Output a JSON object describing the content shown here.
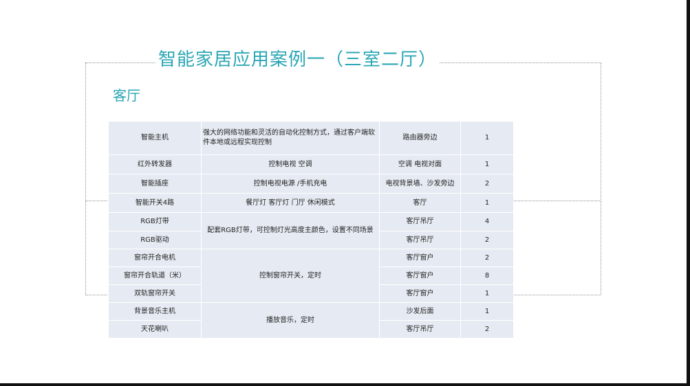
{
  "slide": {
    "title": "智能家居应用案例一（三室二厅）",
    "subtitle": "客厅"
  },
  "table": {
    "rows": [
      {
        "name": "智能主机",
        "desc": "强大的网络功能和灵活的自动化控制方式，通过客户端软件本地或远程实现控制",
        "location": "路由器旁边",
        "qty": "1"
      },
      {
        "name": "红外转发器",
        "desc": "控制电视 空调",
        "location": "空调 电视对面",
        "qty": "1"
      },
      {
        "name": "智能插座",
        "desc": "控制电视电源 /手机充电",
        "location": "电视背景墙、沙发旁边",
        "qty": "2"
      },
      {
        "name": "智能开关4路",
        "desc": "餐厅灯 客厅灯 门厅 休闲模式",
        "location": "客厅",
        "qty": "1"
      },
      {
        "name": "RGB灯带",
        "location": "客厅吊厅",
        "qty": "4"
      },
      {
        "name": "RGB驱动",
        "location": "客厅吊厅",
        "qty": "2"
      },
      {
        "name": "窗帘开合电机",
        "location": "客厅窗户",
        "qty": "2"
      },
      {
        "name": "窗帘开合轨道（米）",
        "location": "客厅窗户",
        "qty": "8"
      },
      {
        "name": "双轨窗帘开关",
        "location": "客厅窗户",
        "qty": "1"
      },
      {
        "name": "背景音乐主机",
        "location": "沙发后面",
        "qty": "1"
      },
      {
        "name": "天花喇叭",
        "location": "客厅吊厅",
        "qty": "2"
      }
    ],
    "merged_desc": {
      "rgb": "配套RGB灯带，可控制灯光高度主颜色，设置不同场景",
      "curtain": "控制窗帘开关，定时",
      "music": "播放音乐，定时"
    }
  }
}
